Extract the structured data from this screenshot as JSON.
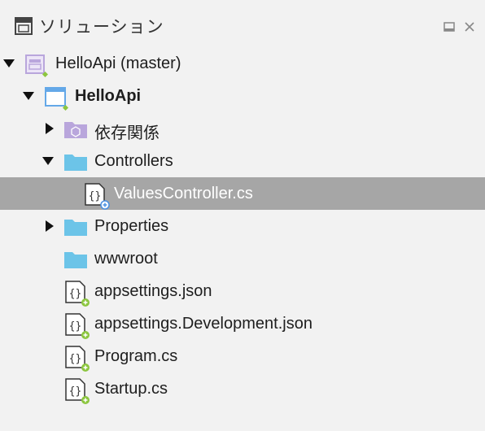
{
  "pad": {
    "title": "ソリューション",
    "icon": "solution-pad-icon",
    "buttons": [
      "maximize-icon",
      "close-icon"
    ]
  },
  "tree": {
    "solution": {
      "label": "HelloApi (master)",
      "icon": "solution-icon",
      "expanded": true
    },
    "project": {
      "label": "HelloApi",
      "icon": "project-icon",
      "expanded": true
    },
    "items": [
      {
        "label": "依存関係",
        "icon": "dependencies-folder-icon",
        "expanded": false
      },
      {
        "label": "Controllers",
        "icon": "folder-icon",
        "expanded": true
      },
      {
        "label": "ValuesController.cs",
        "icon": "code-file-icon",
        "selected": true
      },
      {
        "label": "Properties",
        "icon": "folder-icon",
        "expanded": false
      },
      {
        "label": "wwwroot",
        "icon": "folder-icon"
      },
      {
        "label": "appsettings.json",
        "icon": "code-file-icon"
      },
      {
        "label": "appsettings.Development.json",
        "icon": "code-file-icon"
      },
      {
        "label": "Program.cs",
        "icon": "code-file-icon"
      },
      {
        "label": "Startup.cs",
        "icon": "code-file-icon"
      }
    ]
  },
  "colors": {
    "selection": "#a6a6a6",
    "folder": "#6cc4e8",
    "solution_icon": "#b9a6dc",
    "project_icon": "#64a8e8",
    "added_badge": "#8cc63f",
    "pending_badge": "#4a90e2"
  }
}
